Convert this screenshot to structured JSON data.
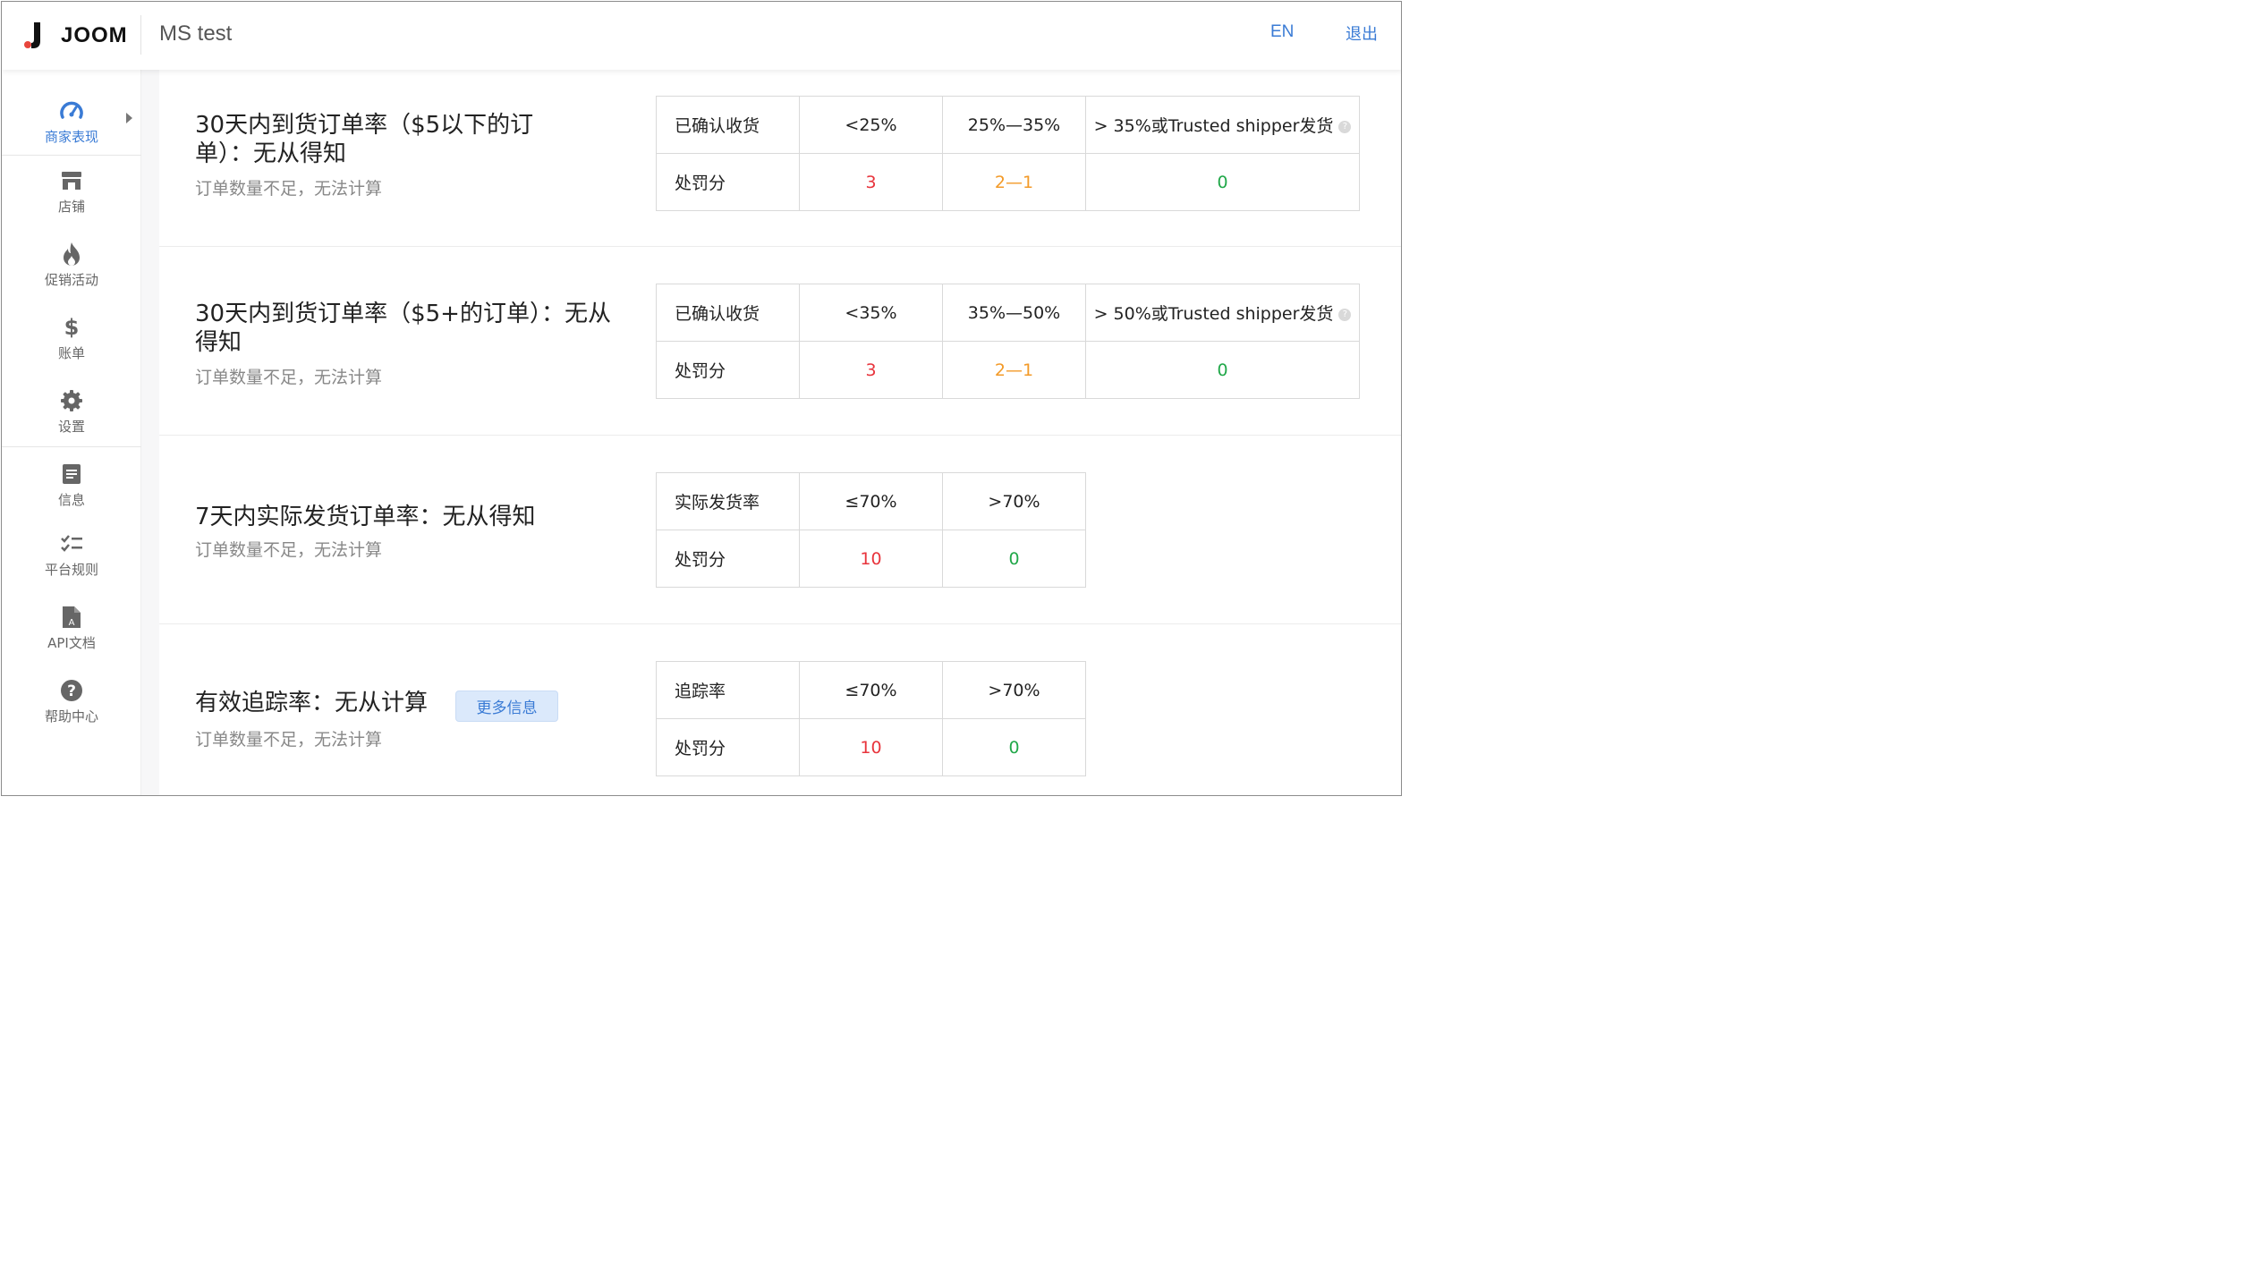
{
  "header": {
    "brand": "JOOM",
    "store_name": "MS test",
    "lang": "EN",
    "logout": "退出"
  },
  "sidebar": {
    "items": [
      {
        "label": "商家表现",
        "icon": "speedometer-icon",
        "active": true
      },
      {
        "label": "店铺",
        "icon": "store-icon"
      },
      {
        "label": "促销活动",
        "icon": "fire-icon"
      },
      {
        "label": "账单",
        "icon": "dollar-icon"
      },
      {
        "label": "设置",
        "icon": "gear-icon"
      },
      {
        "label": "信息",
        "icon": "document-icon"
      },
      {
        "label": "平台规则",
        "icon": "checklist-icon"
      },
      {
        "label": "API文档",
        "icon": "api-file-icon"
      },
      {
        "label": "帮助中心",
        "icon": "help-circle-icon"
      }
    ]
  },
  "metrics": [
    {
      "title": "30天内到货订单率（$5以下的订单）：无从得知",
      "subtitle": "订单数量不足，无法计算",
      "rows": [
        [
          "已确认收货",
          "<25%",
          "25%—35%",
          "> 35%或Trusted shipper发货"
        ],
        [
          "处罚分",
          "3",
          "2—1",
          "0"
        ]
      ]
    },
    {
      "title": "30天内到货订单率（$5+的订单）：无从得知",
      "subtitle": "订单数量不足，无法计算",
      "rows": [
        [
          "已确认收货",
          "<35%",
          "35%—50%",
          "> 50%或Trusted shipper发货"
        ],
        [
          "处罚分",
          "3",
          "2—1",
          "0"
        ]
      ]
    },
    {
      "title": "7天内实际发货订单率：无从得知",
      "subtitle": "订单数量不足，无法计算",
      "rows": [
        [
          "实际发货率",
          "≤70%",
          ">70%"
        ],
        [
          "处罚分",
          "10",
          "0"
        ]
      ]
    },
    {
      "title": "有效追踪率：无从计算",
      "subtitle": "订单数量不足，无法计算",
      "more_info": "更多信息",
      "rows": [
        [
          "追踪率",
          "≤70%",
          ">70%"
        ],
        [
          "处罚分",
          "10",
          "0"
        ]
      ]
    }
  ],
  "colors": {
    "accent": "#3a7bd5",
    "penalty_high": "#e8343c",
    "penalty_mid": "#f39a28",
    "penalty_zero": "#22a84a"
  }
}
